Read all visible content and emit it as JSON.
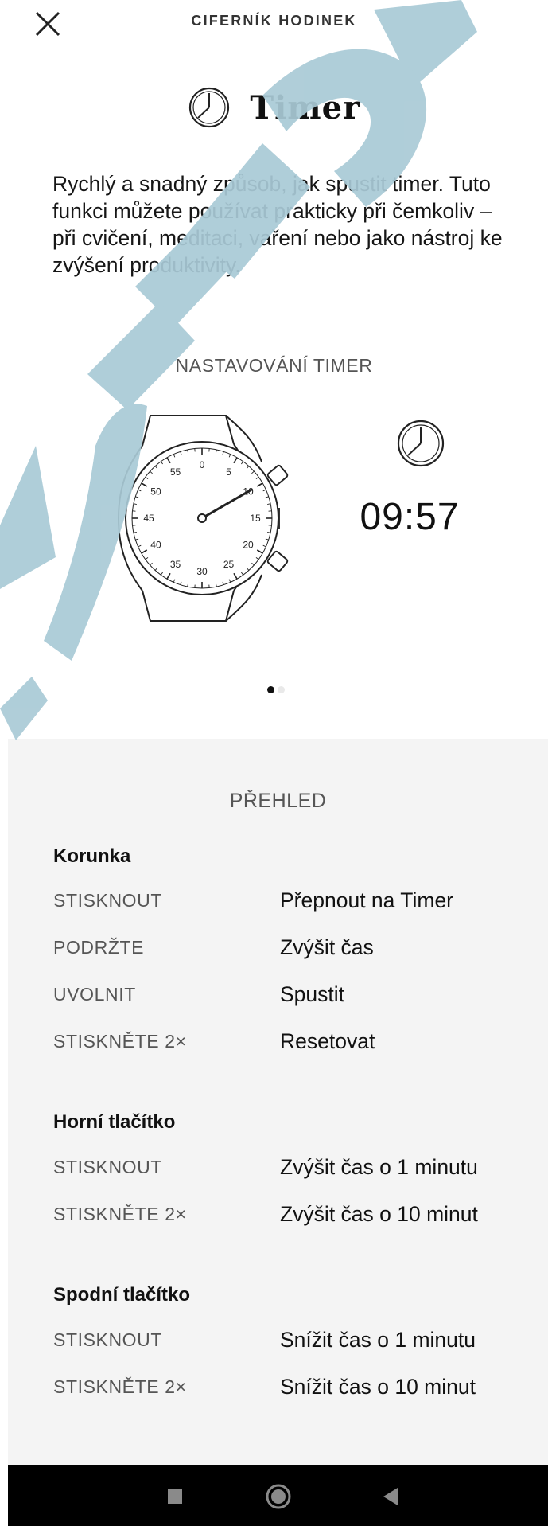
{
  "header": {
    "title": "CIFERNÍK HODINEK",
    "close_icon": "close-icon"
  },
  "feature": {
    "title": "Timer",
    "icon": "clock-icon",
    "description": "Rychlý a snadný způsob, jak spustit timer. Tuto funkci můžete používat prakticky při čemkoliv – při cvičení, meditaci, vaření nebo jako nástroj ke zvýšení produktivity."
  },
  "setting": {
    "label": "NASTAVOVÁNÍ TIMER",
    "readout": "09:57",
    "dial_numbers": [
      "0",
      "5",
      "10",
      "15",
      "20",
      "25",
      "30",
      "35",
      "40",
      "45",
      "50",
      "55"
    ],
    "hand_value": 10
  },
  "pager": {
    "count": 2,
    "active": 1
  },
  "overview": {
    "title": "PŘEHLED",
    "sections": [
      {
        "heading": "Korunka",
        "rows": [
          {
            "action": "STISKNOUT",
            "result": "Přepnout na Timer"
          },
          {
            "action": "PODRŽTE",
            "result": "Zvýšit čas"
          },
          {
            "action": "UVOLNIT",
            "result": "Spustit"
          },
          {
            "action": "STISKNĚTE 2×",
            "result": "Resetovat"
          }
        ]
      },
      {
        "heading": "Horní tlačítko",
        "rows": [
          {
            "action": "STISKNOUT",
            "result": "Zvýšit čas o 1 minutu"
          },
          {
            "action": "STISKNĚTE 2×",
            "result": "Zvýšit čas o 10 minut"
          }
        ]
      },
      {
        "heading": "Spodní tlačítko",
        "rows": [
          {
            "action": "STISKNOUT",
            "result": "Snížit čas o 1 minutu"
          },
          {
            "action": "STISKNĚTE 2×",
            "result": "Snížit čas o 10 minut"
          }
        ]
      }
    ]
  },
  "system_nav": {
    "icons": [
      "recents-square-icon",
      "home-circle-icon",
      "back-triangle-icon"
    ]
  },
  "colors": {
    "watermark": "#a9cad6",
    "overview_bg": "#f4f4f4",
    "navbar_bg": "#000000"
  }
}
